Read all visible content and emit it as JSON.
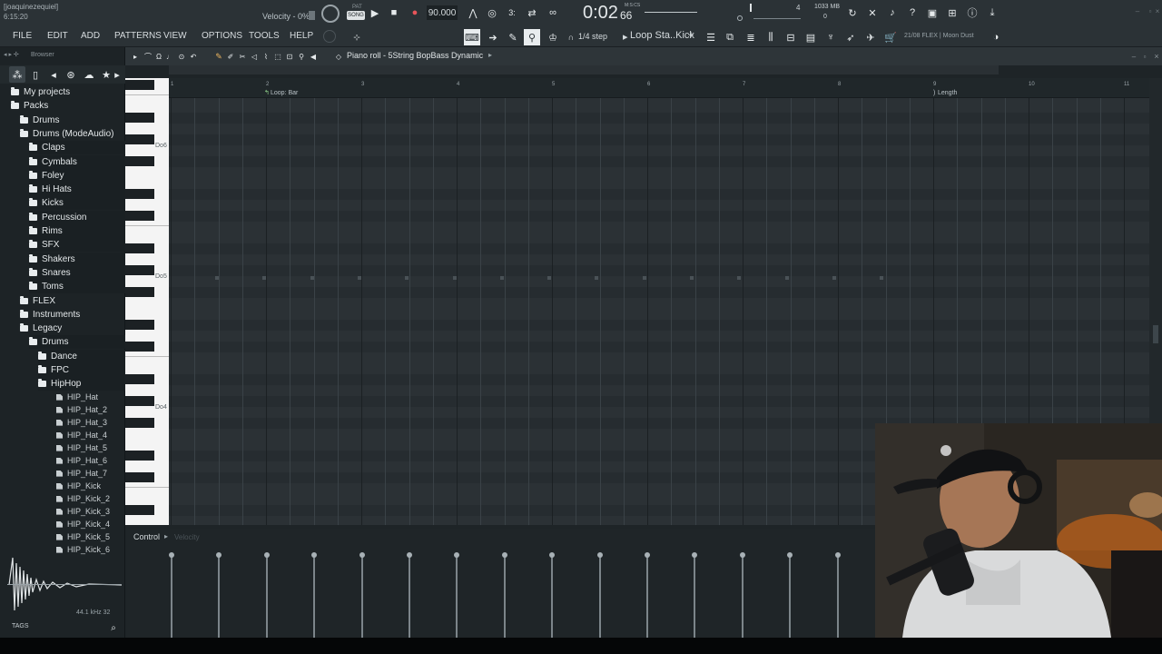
{
  "title": {
    "user": "[joaquinezequiel]",
    "time": "6:15:20"
  },
  "transport": {
    "velocity_label": "Velocity - 0%",
    "mode_pat": "PAT",
    "mode_song": "SONG",
    "tempo": "90.000",
    "time_main": "0:02",
    "time_frac": "66",
    "time_unit": "M:S:CS",
    "beat": "4",
    "cpu": "1033 MB",
    "polyphony": "0",
    "step_label": "1/4 step",
    "pattern": "Loop Sta..Kick",
    "plugin_info": "21/08  FLEX | Moon Dust"
  },
  "menu": [
    "FILE",
    "EDIT",
    "ADD",
    "PATTERNS",
    "VIEW",
    "OPTIONS",
    "TOOLS",
    "HELP"
  ],
  "browser": {
    "label": "Browser",
    "items": [
      {
        "label": "My projects",
        "depth": 0,
        "kind": "folder"
      },
      {
        "label": "Packs",
        "depth": 0,
        "kind": "folder"
      },
      {
        "label": "Drums",
        "depth": 1,
        "kind": "folder"
      },
      {
        "label": "Drums (ModeAudio)",
        "depth": 1,
        "kind": "folder"
      },
      {
        "label": "Claps",
        "depth": 2,
        "kind": "folder"
      },
      {
        "label": "Cymbals",
        "depth": 2,
        "kind": "folder"
      },
      {
        "label": "Foley",
        "depth": 2,
        "kind": "folder"
      },
      {
        "label": "Hi Hats",
        "depth": 2,
        "kind": "folder"
      },
      {
        "label": "Kicks",
        "depth": 2,
        "kind": "folder"
      },
      {
        "label": "Percussion",
        "depth": 2,
        "kind": "folder"
      },
      {
        "label": "Rims",
        "depth": 2,
        "kind": "folder"
      },
      {
        "label": "SFX",
        "depth": 2,
        "kind": "folder"
      },
      {
        "label": "Shakers",
        "depth": 2,
        "kind": "folder"
      },
      {
        "label": "Snares",
        "depth": 2,
        "kind": "folder"
      },
      {
        "label": "Toms",
        "depth": 2,
        "kind": "folder"
      },
      {
        "label": "FLEX",
        "depth": 1,
        "kind": "folder"
      },
      {
        "label": "Instruments",
        "depth": 1,
        "kind": "folder"
      },
      {
        "label": "Legacy",
        "depth": 1,
        "kind": "folder"
      },
      {
        "label": "Drums",
        "depth": 2,
        "kind": "folder"
      },
      {
        "label": "Dance",
        "depth": 3,
        "kind": "folder"
      },
      {
        "label": "FPC",
        "depth": 3,
        "kind": "folder"
      },
      {
        "label": "HipHop",
        "depth": 3,
        "kind": "folder"
      },
      {
        "label": "HIP_Hat",
        "depth": 4,
        "kind": "file"
      },
      {
        "label": "HIP_Hat_2",
        "depth": 4,
        "kind": "file"
      },
      {
        "label": "HIP_Hat_3",
        "depth": 4,
        "kind": "file"
      },
      {
        "label": "HIP_Hat_4",
        "depth": 4,
        "kind": "file"
      },
      {
        "label": "HIP_Hat_5",
        "depth": 4,
        "kind": "file"
      },
      {
        "label": "HIP_Hat_6",
        "depth": 4,
        "kind": "file"
      },
      {
        "label": "HIP_Hat_7",
        "depth": 4,
        "kind": "file"
      },
      {
        "label": "HIP_Kick",
        "depth": 4,
        "kind": "file"
      },
      {
        "label": "HIP_Kick_2",
        "depth": 4,
        "kind": "file"
      },
      {
        "label": "HIP_Kick_3",
        "depth": 4,
        "kind": "file"
      },
      {
        "label": "HIP_Kick_4",
        "depth": 4,
        "kind": "file"
      },
      {
        "label": "HIP_Kick_5",
        "depth": 4,
        "kind": "file"
      },
      {
        "label": "HIP_Kick_6",
        "depth": 4,
        "kind": "file"
      }
    ],
    "sample_info": "44.1 kHz 32",
    "tags_label": "TAGS"
  },
  "piano_roll": {
    "title": "Piano roll - 5String BopBass Dynamic",
    "loop_label": "Loop: Bar",
    "length_label": "Length",
    "bars": [
      "1",
      "2",
      "3",
      "4",
      "5",
      "6",
      "7",
      "8",
      "9",
      "10",
      "11"
    ],
    "octave_labels": [
      "Do6",
      "Do5",
      "Do4"
    ],
    "control_label": "Control",
    "control_param": "Velocity"
  },
  "colors": {
    "accent_green": "#8fd18a",
    "grid_bg": "#2b3135",
    "panel": "#2b3236"
  }
}
